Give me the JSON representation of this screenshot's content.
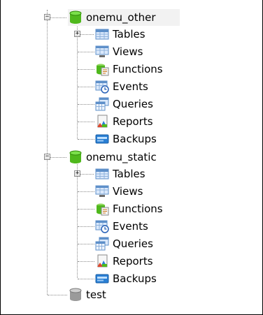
{
  "databases": [
    {
      "name": "onemu_other",
      "icon": "database-green-icon",
      "expanded": true,
      "children": [
        {
          "label": "Tables",
          "icon": "table-icon",
          "expandable": true
        },
        {
          "label": "Views",
          "icon": "view-icon"
        },
        {
          "label": "Functions",
          "icon": "function-icon"
        },
        {
          "label": "Events",
          "icon": "event-icon"
        },
        {
          "label": "Queries",
          "icon": "query-icon"
        },
        {
          "label": "Reports",
          "icon": "report-icon"
        },
        {
          "label": "Backups",
          "icon": "backup-icon"
        }
      ]
    },
    {
      "name": "onemu_static",
      "icon": "database-green-icon",
      "expanded": true,
      "children": [
        {
          "label": "Tables",
          "icon": "table-icon",
          "expandable": true
        },
        {
          "label": "Views",
          "icon": "view-icon"
        },
        {
          "label": "Functions",
          "icon": "function-icon"
        },
        {
          "label": "Events",
          "icon": "event-icon"
        },
        {
          "label": "Queries",
          "icon": "query-icon"
        },
        {
          "label": "Reports",
          "icon": "report-icon"
        },
        {
          "label": "Backups",
          "icon": "backup-icon"
        }
      ]
    },
    {
      "name": "test",
      "icon": "database-gray-icon",
      "expanded": false,
      "children": []
    }
  ],
  "expander": {
    "collapse": "−",
    "expand": "+"
  },
  "colors": {
    "db_green": "#4fb81c",
    "db_gray": "#9a9a9a",
    "accent_blue": "#2a7fd4",
    "selected_row": "#f2f2f2"
  }
}
